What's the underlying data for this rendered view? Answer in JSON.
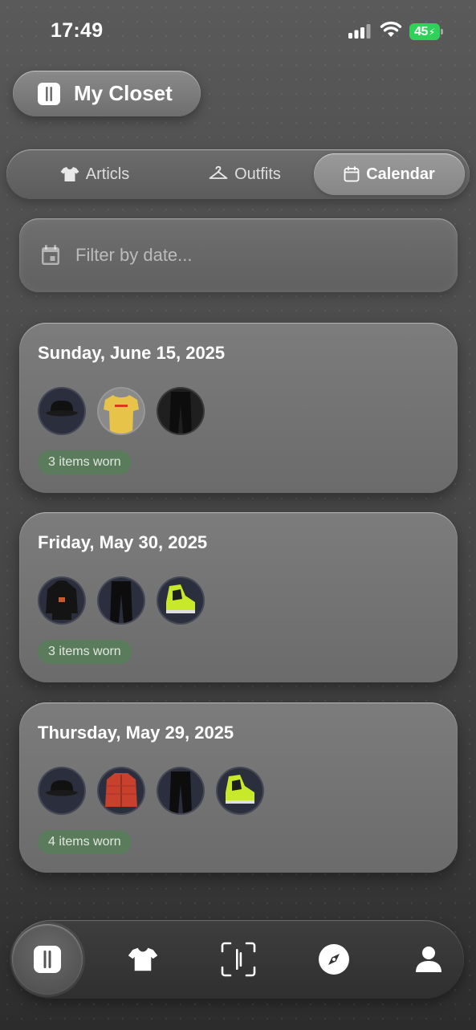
{
  "status_bar": {
    "time": "17:49",
    "battery": "45"
  },
  "header": {
    "title": "My Closet",
    "icon": "closet-icon"
  },
  "tabs": [
    {
      "label": "Articls",
      "icon": "tshirt-icon",
      "active": false
    },
    {
      "label": "Outfits",
      "icon": "hanger-icon",
      "active": false
    },
    {
      "label": "Calendar",
      "icon": "calendar-icon",
      "active": true
    }
  ],
  "filter": {
    "placeholder": "Filter by date..."
  },
  "entries": [
    {
      "date": "Sunday, June 15, 2025",
      "items": [
        "bucket-hat",
        "yellow-dhl-shirt",
        "black-pants"
      ],
      "badge": "3 items worn"
    },
    {
      "date": "Friday, May 30, 2025",
      "items": [
        "black-hoodie",
        "black-pants",
        "neon-sneaker"
      ],
      "badge": "3 items worn"
    },
    {
      "date": "Thursday, May 29, 2025",
      "items": [
        "bucket-hat",
        "red-puffer-jacket",
        "black-pants",
        "neon-sneaker"
      ],
      "badge": "4 items worn"
    }
  ],
  "bottom_nav": [
    {
      "icon": "closet-icon",
      "active": true
    },
    {
      "icon": "tshirt-icon",
      "active": false
    },
    {
      "icon": "scan-icon",
      "active": false
    },
    {
      "icon": "compass-icon",
      "active": false
    },
    {
      "icon": "profile-icon",
      "active": false
    }
  ],
  "colors": {
    "badge": "#5b7c5c",
    "battery": "#2fd158"
  }
}
